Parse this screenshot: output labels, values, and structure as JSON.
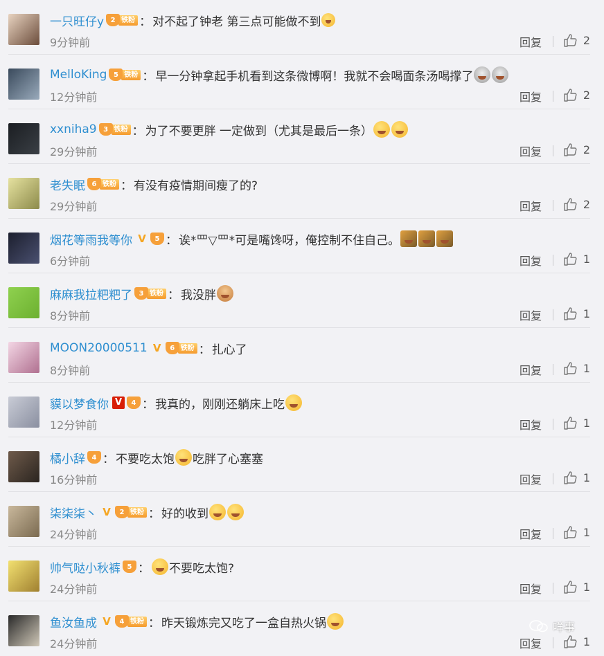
{
  "comments": [
    {
      "name": "一只旺仔y",
      "vip": "",
      "level": "2",
      "iron": "铁粉",
      "text": "对不起了钟老 第三点可能做不到",
      "emojis": [
        "tiny"
      ],
      "time": "9分钟前",
      "reply": "回复",
      "likes": "2",
      "avatar": [
        "#e8d3c0",
        "#6b4c3b"
      ]
    },
    {
      "name": "MelloKing",
      "vip": "",
      "level": "5",
      "iron": "铁粉",
      "text": "早一分钟拿起手机看到这条微博啊！我就不会喝面条汤喝撑了",
      "emojis": [
        "eyes",
        "eyes"
      ],
      "time": "12分钟前",
      "reply": "回复",
      "likes": "2",
      "avatar": [
        "#3a4a5c",
        "#9ab"
      ]
    },
    {
      "name": "xxniha9",
      "vip": "",
      "level": "3",
      "iron": "铁粉",
      "text": "为了不要更胖 一定做到（尤其是最后一条）",
      "emojis": [
        "laugh",
        "laugh"
      ],
      "time": "29分钟前",
      "reply": "回复",
      "likes": "2",
      "avatar": [
        "#1b1e22",
        "#3a3f45"
      ]
    },
    {
      "name": "老失眠",
      "vip": "",
      "level": "6",
      "iron": "铁粉",
      "text": "有没有疫情期间瘦了的?",
      "emojis": [],
      "time": "29分钟前",
      "reply": "回复",
      "likes": "2",
      "avatar": [
        "#e6e2a0",
        "#8c8a4a"
      ]
    },
    {
      "name": "烟花等雨我等你",
      "vip": "orange",
      "level": "5",
      "iron": "",
      "text": "诶*罒▽罒*可是嘴馋呀，俺控制不住自己。",
      "emojis": [
        "gavel",
        "gavel",
        "gavel"
      ],
      "time": "6分钟前",
      "reply": "回复",
      "likes": "1",
      "avatar": [
        "#1c1f2e",
        "#4a5070"
      ]
    },
    {
      "name": "麻麻我拉粑粑了",
      "vip": "",
      "level": "3",
      "iron": "铁粉",
      "text": "我没胖",
      "emojis": [
        "person"
      ],
      "time": "8分钟前",
      "reply": "回复",
      "likes": "1",
      "avatar": [
        "#8fd14f",
        "#6cb030"
      ]
    },
    {
      "name": "MOON20000511",
      "vip": "orange",
      "level": "6",
      "iron": "铁粉",
      "text": "扎心了",
      "emojis": [],
      "time": "8分钟前",
      "reply": "回复",
      "likes": "1",
      "avatar": [
        "#f3d6e4",
        "#b07090"
      ]
    },
    {
      "name": "貘以梦食你",
      "vip": "red",
      "level": "4",
      "iron": "",
      "text": "我真的，刚刚还躺床上吃",
      "emojis": [
        "laugh"
      ],
      "time": "12分钟前",
      "reply": "回复",
      "likes": "1",
      "avatar": [
        "#c9ccd6",
        "#8a8fa0"
      ]
    },
    {
      "name": "橘小辞",
      "vip": "",
      "level": "4",
      "iron": "",
      "text": "不要吃太饱",
      "text2": "吃胖了心塞塞",
      "emojis": [
        "laugh"
      ],
      "time": "16分钟前",
      "reply": "回复",
      "likes": "1",
      "avatar": [
        "#6e5a4a",
        "#2b2520"
      ]
    },
    {
      "name": "柒柒柒丶",
      "vip": "orange",
      "level": "2",
      "iron": "铁粉",
      "text": "好的收到",
      "emojis": [
        "laugh",
        "laugh"
      ],
      "time": "24分钟前",
      "reply": "回复",
      "likes": "1",
      "avatar": [
        "#c9b89c",
        "#7a6a50"
      ]
    },
    {
      "name": "帅气哒小秋裤",
      "vip": "",
      "level": "5",
      "iron": "",
      "text": "不要吃太饱?",
      "emojis": [],
      "preemoji": true,
      "time": "24分钟前",
      "reply": "回复",
      "likes": "1",
      "avatar": [
        "#f2e070",
        "#a08030"
      ]
    },
    {
      "name": "鱼汝鱼成",
      "vip": "orange",
      "level": "4",
      "iron": "铁粉",
      "text": "昨天锻炼完又吃了一盒自热火锅",
      "emojis": [
        "laugh"
      ],
      "time": "24分钟前",
      "reply": "回复",
      "likes": "1",
      "avatar": [
        "#2a2a2a",
        "#d0c8b8"
      ]
    }
  ],
  "watermark": {
    "text": "咩事",
    "icon": "wechat-icon"
  },
  "icons": {
    "like": "thumbs-up-icon",
    "vip": "v-icon",
    "badge": "crown-icon"
  },
  "colors": {
    "name": "#2f8fd0",
    "vip_orange": "#f5a623",
    "vip_red": "#d81e06",
    "background": "#f2f2f5"
  }
}
